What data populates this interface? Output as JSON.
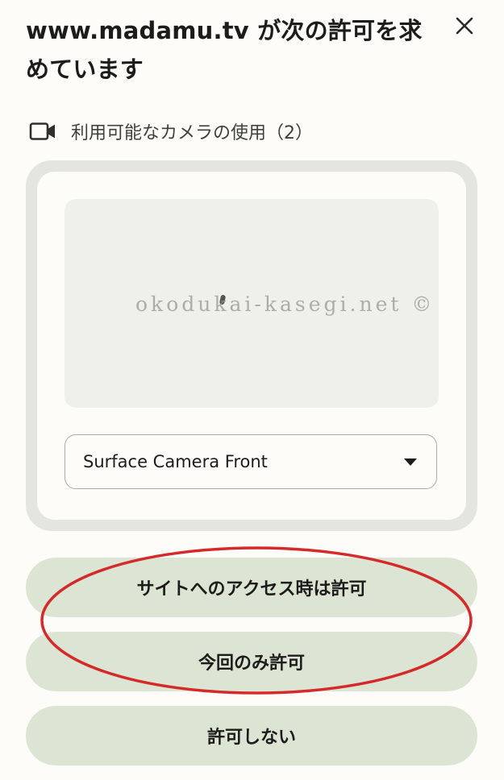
{
  "dialog": {
    "title": "www.madamu.tv が次の許可を求めています",
    "close_icon": "close-icon",
    "permission": {
      "icon": "video-camera-icon",
      "text": "利用可能なカメラの使用（2）"
    },
    "preview": {
      "watermark": "okodukai-kasegi.net ©",
      "camera_select": {
        "selected": "Surface Camera Front",
        "icon": "caret-down-icon"
      }
    },
    "buttons": {
      "allow_while_visiting": "サイトへのアクセス時は許可",
      "allow_this_time": "今回のみ許可",
      "never_allow": "許可しない"
    },
    "annotation_color": "#d42a2a"
  }
}
